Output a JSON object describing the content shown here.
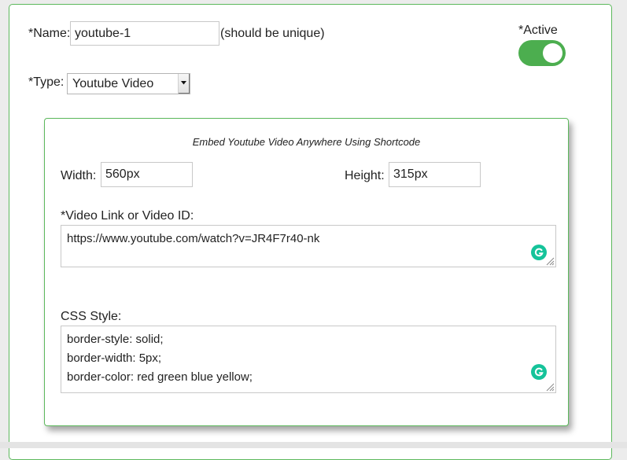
{
  "form": {
    "name_label": "*Name:",
    "name_value": "youtube-1",
    "name_hint": "(should be unique)",
    "type_label": "*Type:",
    "type_value": "Youtube Video",
    "active_label": "*Active",
    "active_on": true
  },
  "embed": {
    "caption": "Embed Youtube Video Anywhere Using Shortcode",
    "width_label": "Width:",
    "width_value": "560px",
    "height_label": "Height:",
    "height_value": "315px",
    "video_label": "*Video Link or Video ID:",
    "video_value": "https://www.youtube.com/watch?v=JR4F7r40-nk",
    "css_label": "CSS Style:",
    "css_lines": [
      "border-style: solid;",
      "border-width: 5px;",
      "border-color: red green blue yellow;"
    ]
  },
  "colors": {
    "accent": "#5cb85c",
    "toggle_on": "#4cae4f",
    "grammarly": "#15c39a"
  },
  "icons": {
    "select_arrow": "caret-down-icon",
    "grammarly": "grammarly-icon",
    "resize": "resize-grip-icon"
  }
}
